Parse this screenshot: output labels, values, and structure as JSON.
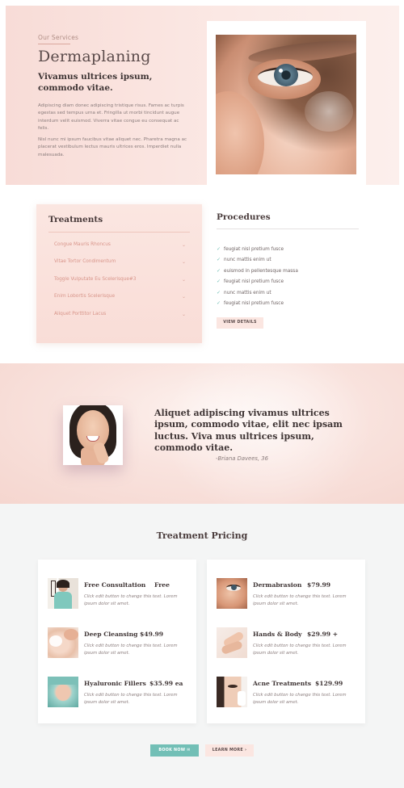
{
  "hero": {
    "eyebrow": "Our Services",
    "title": "Dermaplaning",
    "subtitle": "Vivamus ultrices ipsum, commodo vitae.",
    "paragraph1": "Adipiscing diam donec adipiscing tristique risus. Fames ac turpis egestas sed tempus urna et. Fringilla ut morbi tincidunt augue interdum velit euismod. Viverra vitae congue eu consequat ac felis.",
    "paragraph2": "Nisl nunc mi ipsum faucibus vitae aliquet nec. Pharetra magna ac placerat vestibulum lectus mauris ultrices eros. Imperdiet nulla malesuada."
  },
  "treatments": {
    "heading": "Treatments",
    "items": [
      {
        "label": "Congue Mauris Rhoncus",
        "icon": "chevron-down-icon"
      },
      {
        "label": "Vitae Tortor Condimentum",
        "icon": "chevron-down-icon"
      },
      {
        "label": "Toggle Vulputate Eu Scelerisque#3",
        "icon": "chevron-down-icon"
      },
      {
        "label": "Enim Lobortis Scelerisque",
        "icon": "chevron-down-icon"
      },
      {
        "label": "Aliquet Porttitor Lacus",
        "icon": "chevron-down-icon"
      }
    ]
  },
  "procedures": {
    "heading": "Procedures",
    "items": [
      "feugiat nisl pretium fusce",
      "nunc mattis enim ut",
      "euismod in pellentesque massa",
      "feugiat nisl pretium fusce",
      "nunc mattis enim ut",
      "feugiat nisl pretium fusce"
    ],
    "view_details": "VIEW DETAILS"
  },
  "testimonial": {
    "quote": "Aliquet adipiscing vivamus ultrices ipsum, commodo vitae, elit nec ipsam luctus. Viva mus ultrices ipsum, commodo vitae.",
    "author": "-Briana Davees, 36"
  },
  "pricing": {
    "heading": "Treatment Pricing",
    "left": [
      {
        "title": "Free Consultation",
        "price": "Free",
        "desc": "Click edit button to change this text. Lorem ipsum dolor sit amet."
      },
      {
        "title": "Deep Cleansing",
        "price": "$49.99",
        "desc": "Click edit button to change this text. Lorem ipsum dolor sit amet."
      },
      {
        "title": "Hyaluronic Fillers",
        "price": "$35.99 ea",
        "desc": "Click edit button to change this text. Lorem ipsum dolor sit amet."
      }
    ],
    "right": [
      {
        "title": "Dermabrasion",
        "price": "$79.99",
        "desc": "Click edit button to change this text. Lorem ipsum dolor sit amet."
      },
      {
        "title": "Hands & Body",
        "price": "$29.99 +",
        "desc": "Click edit button to change this text. Lorem ipsum dolor sit amet."
      },
      {
        "title": "Acne Treatments",
        "price": "$129.99",
        "desc": "Click edit button to change this text. Lorem ipsum dolor sit amet."
      }
    ],
    "book_now": "BOOK NOW ✉",
    "learn_more": "LEARN MORE ›"
  },
  "colors": {
    "blush": "#fbe6e1",
    "teal": "#72bfb6",
    "heading": "#3f3535",
    "accent_text": "#d8958a"
  }
}
